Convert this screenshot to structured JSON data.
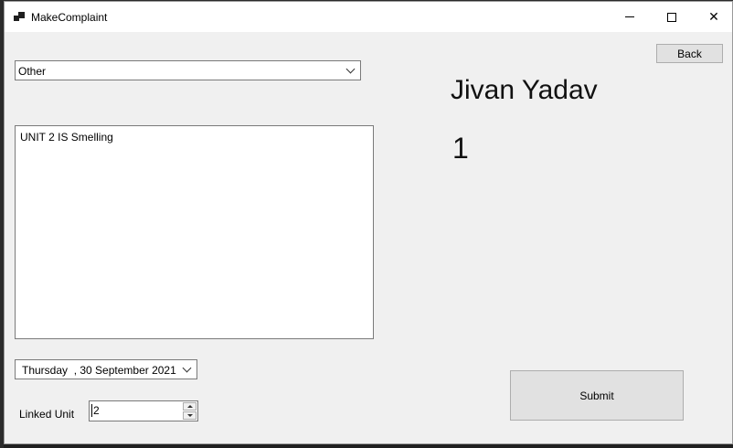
{
  "window": {
    "title": "MakeComplaint",
    "minimize_icon": "minimize-icon",
    "maximize_icon": "maximize-icon",
    "close_icon": "close-icon",
    "close_glyph": "✕"
  },
  "form": {
    "category_select": {
      "selected": "Other"
    },
    "complaint_text": "UNIT 2 IS Smelling",
    "date_picker": {
      "value": "Thursday  , 30 September 2021"
    },
    "linked_unit": {
      "label": "Linked Unit",
      "value": "2"
    }
  },
  "user": {
    "name": "Jivan Yadav",
    "id": "1"
  },
  "buttons": {
    "back": "Back",
    "submit": "Submit"
  }
}
